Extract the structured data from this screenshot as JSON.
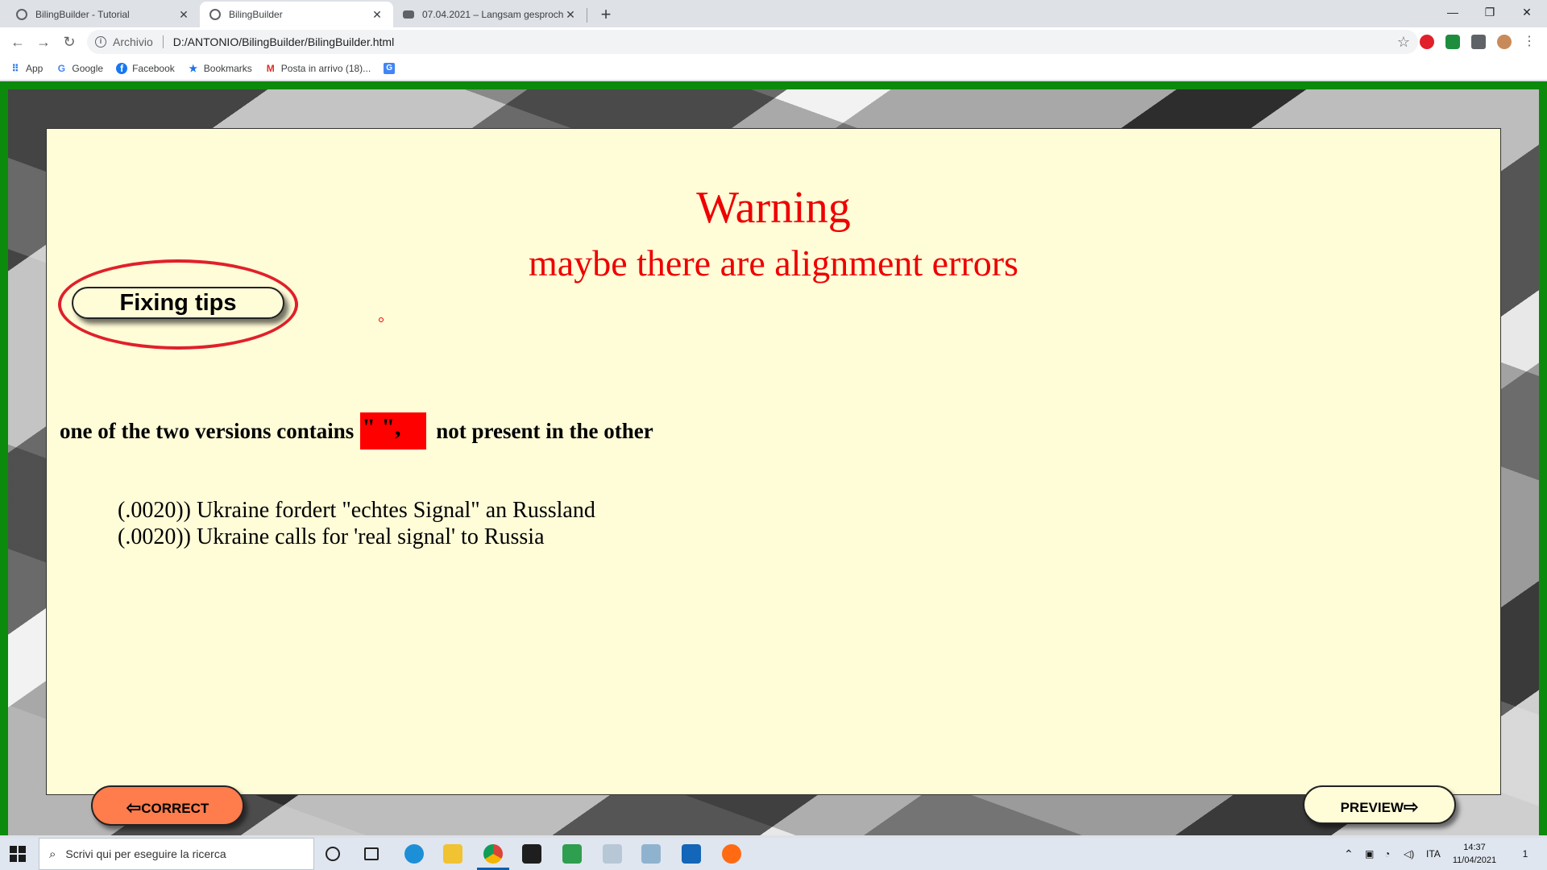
{
  "browser": {
    "tabs": [
      {
        "title": "BilingBuilder - Tutorial",
        "close": "✕"
      },
      {
        "title": "BilingBuilder",
        "close": "✕"
      },
      {
        "title": "07.04.2021 – Langsam gesproche",
        "close": "✕"
      }
    ],
    "new_tab": "+",
    "window_controls": {
      "minimize": "—",
      "restore": "❐",
      "close": "✕"
    },
    "nav": {
      "back": "←",
      "forward": "→",
      "reload": "↻"
    },
    "address": {
      "chip": "Archivio",
      "url": "D:/ANTONIO/BilingBuilder/BilingBuilder.html",
      "star": "☆"
    },
    "bookmarks": [
      {
        "label": "App",
        "icon": "apps-grid-icon"
      },
      {
        "label": "Google",
        "icon": "google-icon"
      },
      {
        "label": "Facebook",
        "icon": "facebook-icon"
      },
      {
        "label": "Bookmarks",
        "icon": "star-icon"
      },
      {
        "label": "Posta in arrivo (18)...",
        "icon": "gmail-icon"
      }
    ]
  },
  "app": {
    "warning_title": "Warning",
    "warning_subtitle": "maybe there are alignment errors",
    "fixing_tips_label": "Fixing tips",
    "message_prefix": "one of the two versions contains",
    "highlight_text": "\" \",",
    "message_suffix": "not present in the other",
    "line_german": "(.0020)) Ukraine fordert \"echtes Signal\" an Russland",
    "line_english": "(.0020)) Ukraine calls for 'real signal' to Russia",
    "correct_label": "CORRECT",
    "preview_label": "PREVIEW",
    "arrow_back": "⇦",
    "arrow_forward": "⇨",
    "colors": {
      "panel": "#fffcd8",
      "warning": "#ee0000",
      "correct_button": "#ff7c4d",
      "frame": "#0c8a0c"
    }
  },
  "taskbar": {
    "search_placeholder": "Scrivi qui per eseguire la ricerca",
    "language": "ITA",
    "time": "14:37",
    "date": "11/04/2021",
    "notification_count": "1"
  }
}
